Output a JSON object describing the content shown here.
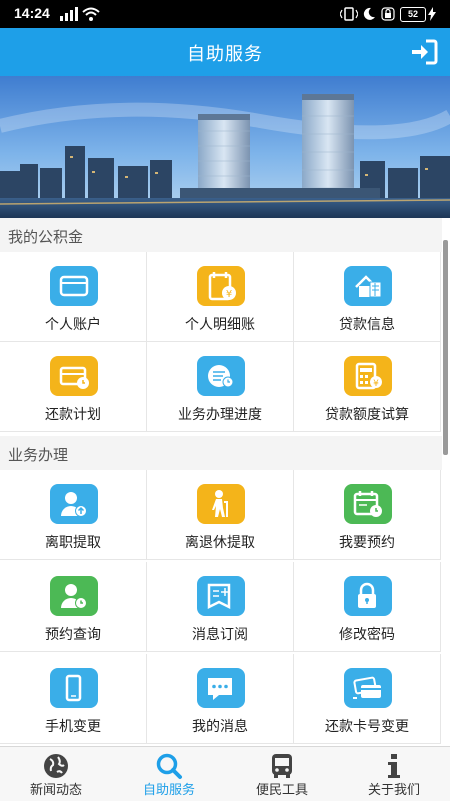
{
  "status_bar": {
    "time": "14:24",
    "battery": "52"
  },
  "header": {
    "title": "自助服务"
  },
  "colors": {
    "accent": "#1e9fe8",
    "blue": "#3aaee8",
    "yellow": "#f4b41a",
    "green": "#4cb955"
  },
  "sections": [
    {
      "title": "我的公积金",
      "items": [
        {
          "label": "个人账户",
          "icon": "wallet-icon",
          "color": "blue"
        },
        {
          "label": "个人明细账",
          "icon": "calendar-yuan-icon",
          "color": "yellow"
        },
        {
          "label": "贷款信息",
          "icon": "house-icon",
          "color": "blue"
        },
        {
          "label": "还款计划",
          "icon": "card-clock-icon",
          "color": "yellow"
        },
        {
          "label": "业务办理进度",
          "icon": "progress-icon",
          "color": "blue"
        },
        {
          "label": "贷款额度试算",
          "icon": "calculator-icon",
          "color": "yellow"
        }
      ]
    },
    {
      "title": "业务办理",
      "items": [
        {
          "label": "离职提取",
          "icon": "person-up-icon",
          "color": "blue"
        },
        {
          "label": "离退休提取",
          "icon": "elderly-icon",
          "color": "yellow"
        },
        {
          "label": "我要预约",
          "icon": "calendar-clock-icon",
          "color": "green"
        },
        {
          "label": "预约查询",
          "icon": "person-clock-icon",
          "color": "green"
        },
        {
          "label": "消息订阅",
          "icon": "subscribe-icon",
          "color": "blue"
        },
        {
          "label": "修改密码",
          "icon": "lock-icon",
          "color": "blue"
        },
        {
          "label": "手机变更",
          "icon": "phone-icon",
          "color": "blue"
        },
        {
          "label": "我的消息",
          "icon": "chat-icon",
          "color": "blue"
        },
        {
          "label": "还款卡号变更",
          "icon": "card-change-icon",
          "color": "blue"
        }
      ]
    }
  ],
  "tabs": [
    {
      "label": "新闻动态",
      "icon": "globe-icon",
      "active": false
    },
    {
      "label": "自助服务",
      "icon": "search-icon",
      "active": true
    },
    {
      "label": "便民工具",
      "icon": "bus-icon",
      "active": false
    },
    {
      "label": "关于我们",
      "icon": "info-icon",
      "active": false
    }
  ]
}
